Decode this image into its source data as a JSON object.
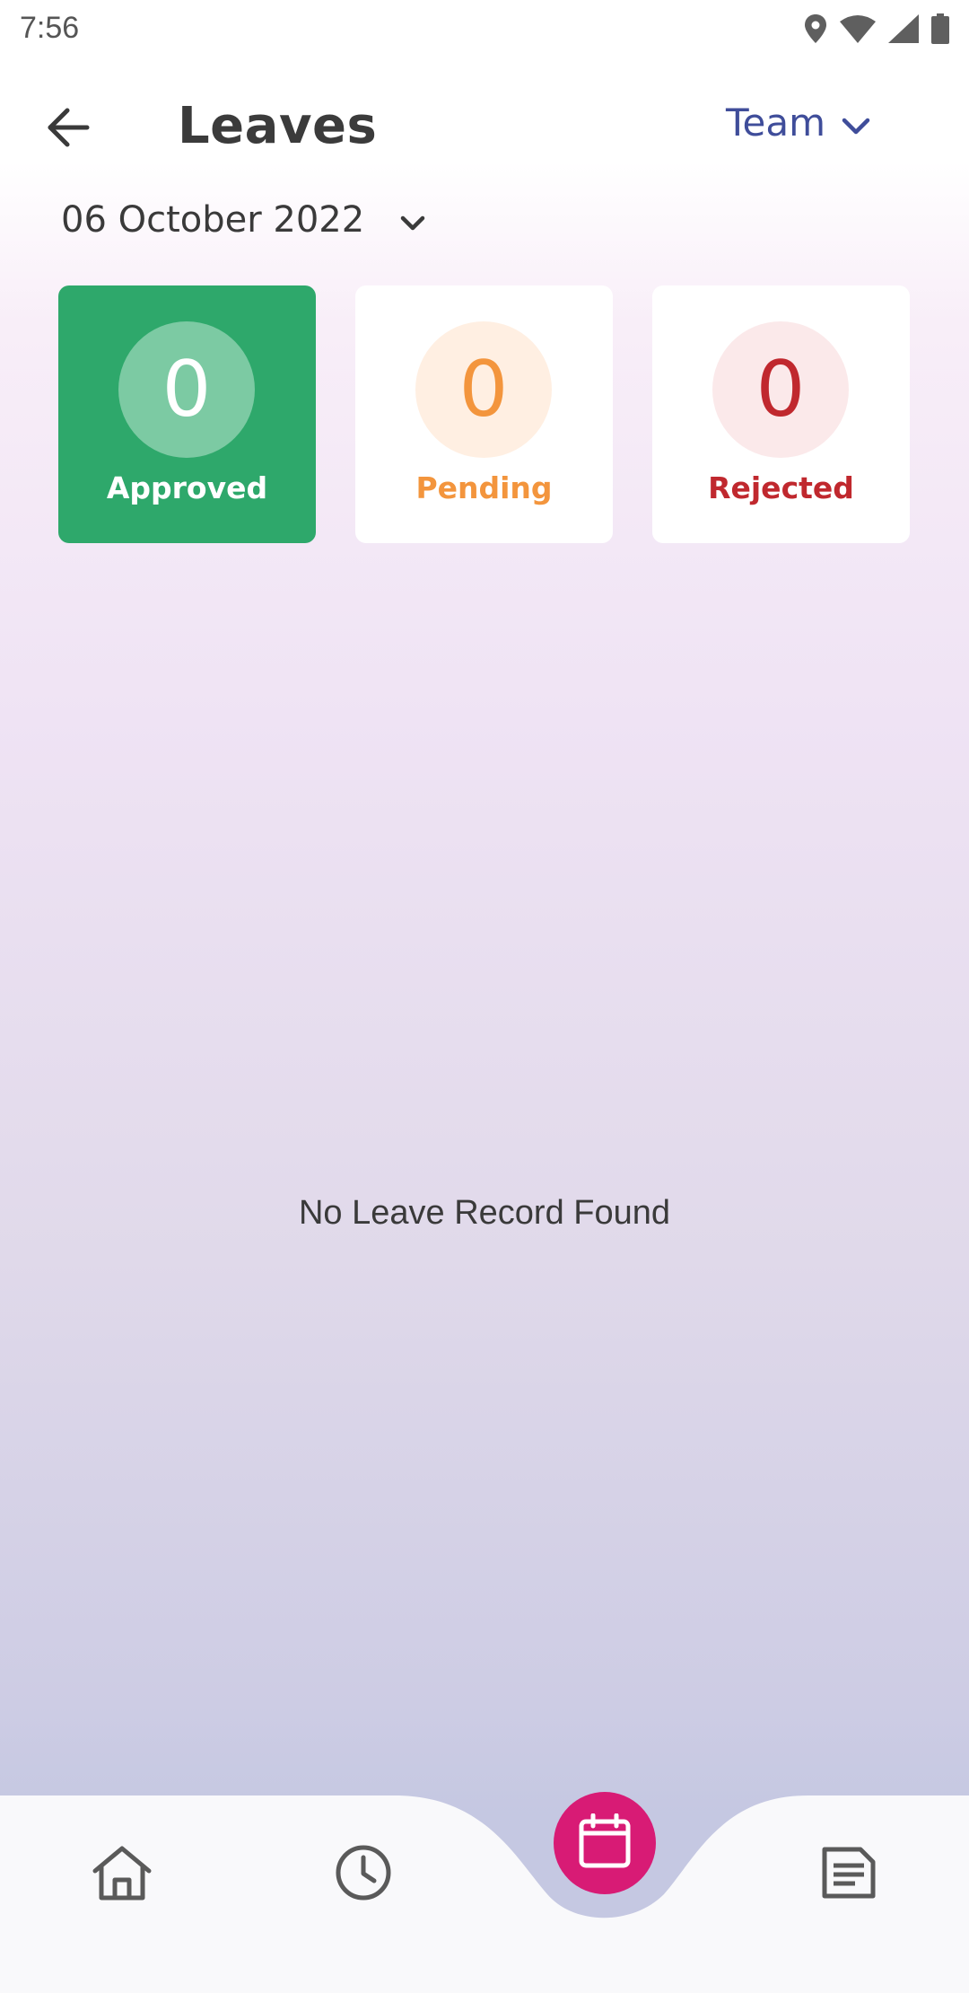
{
  "status_bar": {
    "time": "7:56",
    "icons": [
      "location-icon",
      "wifi-icon",
      "signal-icon",
      "battery-icon"
    ]
  },
  "header": {
    "title": "Leaves",
    "back_icon": "arrow-left-icon",
    "team_filter": {
      "selected": "Team",
      "icon": "chevron-down-icon"
    }
  },
  "date_filter": {
    "selected": "06 October 2022",
    "icon": "chevron-down-icon"
  },
  "summary": {
    "approved": {
      "count": "0",
      "label": "Approved"
    },
    "pending": {
      "count": "0",
      "label": "Pending"
    },
    "rejected": {
      "count": "0",
      "label": "Rejected"
    }
  },
  "empty_state": {
    "message": "No Leave Record Found"
  },
  "bottom_nav": {
    "items": [
      {
        "icon": "home-icon"
      },
      {
        "icon": "clock-icon"
      },
      {
        "icon": "calendar-icon",
        "active": true
      },
      {
        "icon": "document-icon"
      }
    ]
  },
  "colors": {
    "approved": "#2ea86b",
    "pending": "#f3953d",
    "rejected": "#c0282e",
    "accent": "#3f4d9a",
    "fab": "#d81b75"
  }
}
